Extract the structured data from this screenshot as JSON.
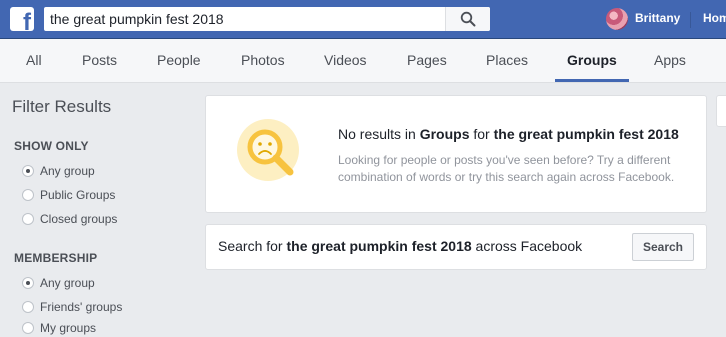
{
  "header": {
    "logo": "f",
    "search_value": "the great pumpkin fest 2018",
    "user_name": "Brittany",
    "home_label": "Hom"
  },
  "tabs": [
    {
      "label": "All"
    },
    {
      "label": "Posts"
    },
    {
      "label": "People"
    },
    {
      "label": "Photos"
    },
    {
      "label": "Videos"
    },
    {
      "label": "Pages"
    },
    {
      "label": "Places"
    },
    {
      "label": "Groups",
      "active": true
    },
    {
      "label": "Apps"
    }
  ],
  "filters": {
    "title": "Filter Results",
    "show_only": {
      "heading": "SHOW ONLY",
      "options": [
        {
          "label": "Any group",
          "selected": true
        },
        {
          "label": "Public Groups",
          "selected": false
        },
        {
          "label": "Closed groups",
          "selected": false
        }
      ]
    },
    "membership": {
      "heading": "MEMBERSHIP",
      "options": [
        {
          "label": "Any group",
          "selected": true
        },
        {
          "label": "Friends' groups",
          "selected": false
        },
        {
          "label": "My groups",
          "selected": false
        }
      ]
    }
  },
  "no_results": {
    "prefix": "No results in ",
    "category": "Groups",
    "middle": " for ",
    "query": "the great pumpkin fest 2018",
    "subtext": "Looking for people or posts you've seen before? Try a different combination of words or try this search again across Facebook."
  },
  "search_facebook": {
    "prefix": "Search for ",
    "query": "the great pumpkin fest 2018",
    "suffix": " across Facebook",
    "button_label": "Search"
  },
  "colors": {
    "brand": "#4267b2",
    "illustration": "#f7c33f"
  },
  "icons": [
    "search-icon",
    "sad-magnifier-icon"
  ]
}
